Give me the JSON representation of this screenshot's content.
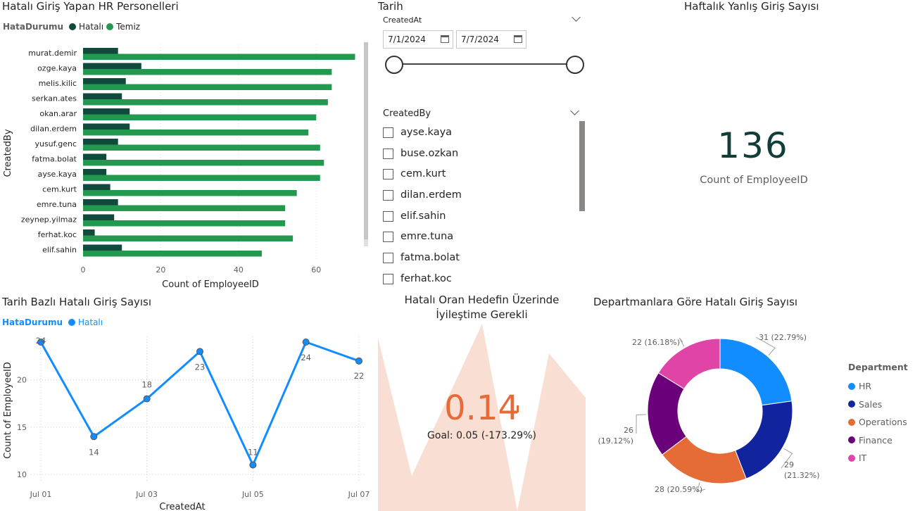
{
  "bar_visual": {
    "title": "Hatalı Giriş Yapan HR Personelleri",
    "legend_title": "HataDurumu",
    "legend": [
      {
        "label": "Hatalı",
        "color": "#0f4a3c"
      },
      {
        "label": "Temiz",
        "color": "#23984f"
      }
    ]
  },
  "date_slicer": {
    "title": "Tarih",
    "field": "CreatedAt",
    "start": "7/1/2024",
    "end": "7/7/2024"
  },
  "list_slicer": {
    "field": "CreatedBy",
    "items": [
      "ayse.kaya",
      "buse.ozkan",
      "cem.kurt",
      "dilan.erdem",
      "elif.sahin",
      "emre.tuna",
      "fatma.bolat",
      "ferhat.koc"
    ]
  },
  "card": {
    "title": "Haftalık Yanlış Giriş Sayısı",
    "value": "136",
    "label": "Count of EmployeeID"
  },
  "line_visual": {
    "title": "Tarih Bazlı Hatalı Giriş Sayısı",
    "legend_title": "HataDurumu",
    "legend_label": "Hatalı",
    "color": "#118dff"
  },
  "kpi": {
    "title_line1": "Hatalı Oran Hedefin Üzerinde",
    "title_line2": "İyileştime Gerekli",
    "value": "0.14",
    "goal": "Goal: 0.05 (-173.29%)",
    "value_color": "#e66c37",
    "bg_color": "#f9ded4"
  },
  "donut_visual": {
    "title": "Departmanlara Göre Hatalı Giriş Sayısı",
    "legend_title": "Department"
  },
  "chart_data": [
    {
      "type": "bar",
      "orientation": "horizontal",
      "categories": [
        "murat.demir",
        "ozge.kaya",
        "melis.kilic",
        "serkan.ates",
        "okan.arar",
        "dilan.erdem",
        "yusuf.genc",
        "fatma.bolat",
        "ayse.kaya",
        "cem.kurt",
        "emre.tuna",
        "zeynep.yilmaz",
        "ferhat.koc",
        "elif.sahin"
      ],
      "series": [
        {
          "name": "Hatalı",
          "values": [
            9,
            15,
            11,
            10,
            12,
            12,
            9,
            6,
            6,
            7,
            9,
            8,
            3,
            10
          ]
        },
        {
          "name": "Temiz",
          "values": [
            70,
            64,
            64,
            63,
            60,
            58,
            61,
            62,
            61,
            55,
            52,
            52,
            54,
            46
          ]
        }
      ],
      "xlabel": "Count of EmployeeID",
      "ylabel": "CreatedBy",
      "xticks": [
        0,
        20,
        40,
        60
      ],
      "xlim": [
        0,
        71
      ],
      "grid": true
    },
    {
      "type": "line",
      "x": [
        "2024-07-01",
        "2024-07-02",
        "2024-07-03",
        "2024-07-04",
        "2024-07-05",
        "2024-07-06",
        "2024-07-07"
      ],
      "xticks": [
        "Jul 01",
        "Jul 03",
        "Jul 05",
        "Jul 07"
      ],
      "series": [
        {
          "name": "Hatalı",
          "values": [
            24,
            14,
            18,
            23,
            11,
            24,
            22
          ]
        }
      ],
      "data_labels": [
        "24",
        "14",
        "18",
        "23",
        "11",
        "24",
        "22"
      ],
      "xlabel": "CreatedAt",
      "ylabel": "Count of EmployeeID",
      "yticks": [
        10,
        15,
        20
      ],
      "ylim": [
        10,
        24
      ],
      "grid": true
    },
    {
      "type": "pie",
      "donut": true,
      "slices": [
        {
          "label": "HR",
          "value": 31,
          "text": "31 (22.79%)",
          "color": "#118dff"
        },
        {
          "label": "Sales",
          "value": 29,
          "text": "29 (21.32%)",
          "color": "#12239e"
        },
        {
          "label": "Operations",
          "value": 28,
          "text": "28 (20.59%)",
          "color": "#e66c37"
        },
        {
          "label": "Finance",
          "value": 26,
          "text": "26 (19.12%)",
          "color": "#6b007b"
        },
        {
          "label": "IT",
          "value": 22,
          "text": "22 (16.18%)",
          "color": "#e044a7"
        }
      ],
      "legend_title": "Department",
      "legend_position": "right"
    }
  ]
}
